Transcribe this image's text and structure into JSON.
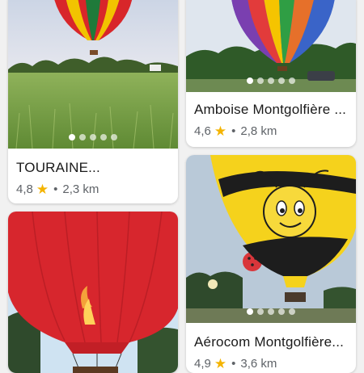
{
  "cards": [
    {
      "title": "TOURAINE...",
      "rating": "4,8",
      "distance": "2,3 km",
      "photo_icon": "hot-air-balloon-field-photo",
      "carousel_dots": 5,
      "active_dot": 0
    },
    {
      "title": "Amboise Montgolfière ...",
      "rating": "4,6",
      "distance": "2,8 km",
      "photo_icon": "rainbow-balloon-photo",
      "carousel_dots": 5,
      "active_dot": 0
    },
    {
      "title": "",
      "photo_icon": "red-balloon-photo"
    },
    {
      "title": "Aérocom Montgolfière...",
      "rating": "4,9",
      "distance": "3,6 km",
      "photo_icon": "bee-balloon-photo",
      "carousel_dots": 5,
      "active_dot": 0
    }
  ],
  "separator": "•",
  "colors": {
    "star": "#f4b400",
    "card_bg": "#ffffff",
    "page_bg": "#f1f1f1"
  }
}
